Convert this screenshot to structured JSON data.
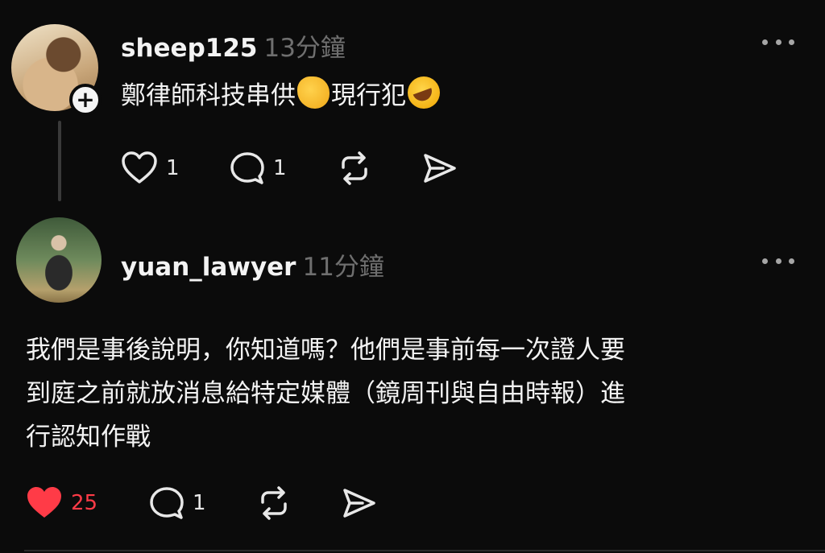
{
  "posts": [
    {
      "username": "sheep125",
      "time": "13分鐘",
      "text_before": "鄭律師科技串供",
      "emoji1": "oncoming-fist",
      "text_middle": "現行犯",
      "emoji2": "rolling-on-floor-laughing",
      "likes": "1",
      "replies": "1",
      "liked": false
    },
    {
      "username": "yuan_lawyer",
      "time": "11分鐘",
      "lines": [
        "我們是事後說明，你知道嗎？他們是事前每一次證人要",
        "到庭之前就放消息給特定媒體（鏡周刊與自由時報）進",
        "行認知作戰"
      ],
      "likes": "25",
      "replies": "1",
      "liked": true,
      "like_color": "#ff3b47"
    }
  ],
  "icons": {
    "follow": "+",
    "like": "heart-icon",
    "reply": "comment-icon",
    "repost": "repost-icon",
    "share": "send-icon",
    "more": "more-icon"
  }
}
